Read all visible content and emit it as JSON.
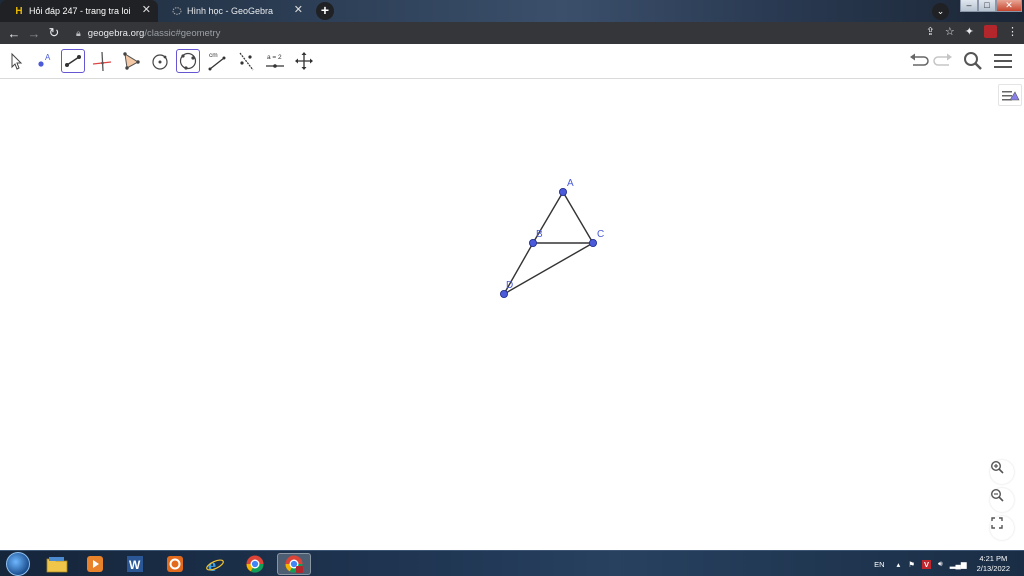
{
  "browser": {
    "tabs": [
      {
        "title": "Hỏi đáp 247 - trang tra loi",
        "favicon": "H",
        "active": true
      },
      {
        "title": "Hình học - GeoGebra",
        "active": false
      }
    ],
    "new_tab": "+",
    "url": {
      "host": "geogebra.org",
      "path": "/classic#geometry"
    }
  },
  "geogebra": {
    "tools": [
      {
        "name": "move-tool-icon",
        "selected": false
      },
      {
        "name": "point-tool-icon",
        "selected": false,
        "glyph": "A"
      },
      {
        "name": "segment-tool-icon",
        "selected": true
      },
      {
        "name": "perpendicular-line-tool-icon",
        "selected": false
      },
      {
        "name": "polygon-tool-icon",
        "selected": false
      },
      {
        "name": "circle-center-point-tool-icon",
        "selected": false
      },
      {
        "name": "circle-three-points-tool-icon",
        "selected": true
      },
      {
        "name": "distance-tool-icon",
        "selected": false,
        "glyph": "cm"
      },
      {
        "name": "reflect-tool-icon",
        "selected": false
      },
      {
        "name": "slider-tool-icon",
        "selected": false,
        "glyph": "a = 2"
      },
      {
        "name": "move-graphics-view-tool-icon",
        "selected": false
      }
    ],
    "accent_color": "#6557d2",
    "point_color": "#4a5ad8",
    "construction": {
      "points": [
        {
          "label": "A"
        },
        {
          "label": "B"
        },
        {
          "label": "C"
        },
        {
          "label": "D"
        }
      ],
      "segments": [
        [
          "A",
          "B"
        ],
        [
          "A",
          "C"
        ],
        [
          "B",
          "C"
        ],
        [
          "B",
          "D"
        ],
        [
          "C",
          "D"
        ]
      ]
    }
  },
  "taskbar": {
    "apps": [
      "file-explorer",
      "media-player",
      "word",
      "office",
      "internet-explorer",
      "chrome",
      "chrome-active"
    ],
    "language": "EN",
    "time": "4:21 PM",
    "date": "2/13/2022"
  }
}
